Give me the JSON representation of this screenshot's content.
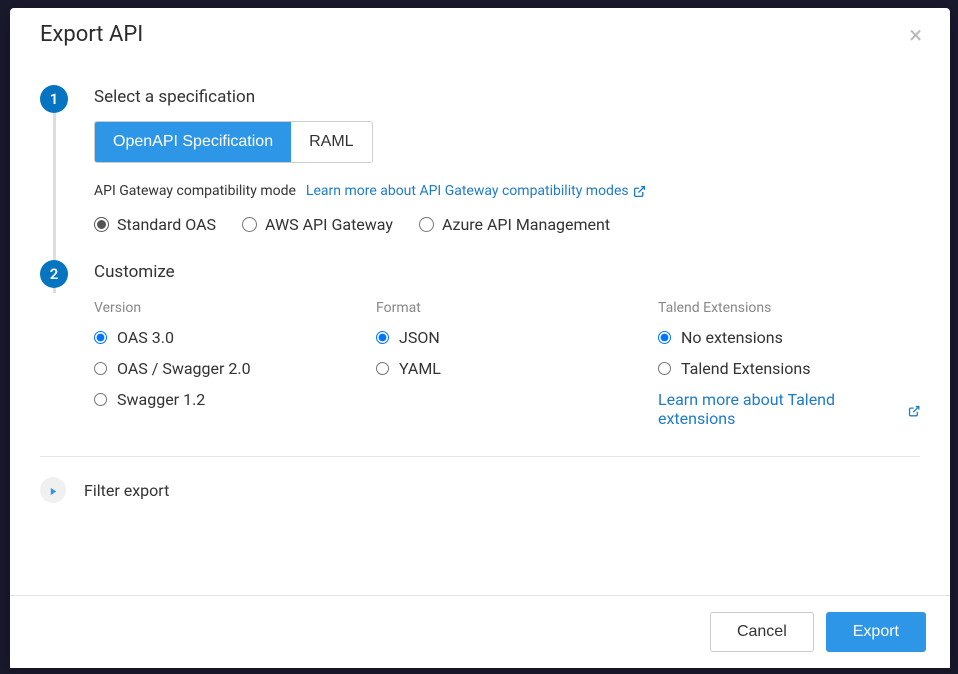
{
  "modal": {
    "title": "Export API",
    "close_label": "×"
  },
  "step1": {
    "number": "1",
    "title": "Select a specification",
    "tabs": {
      "openapi": "OpenAPI Specification",
      "raml": "RAML"
    },
    "compat_label": "API Gateway compatibility mode",
    "compat_link": "Learn more about API Gateway compatibility modes",
    "compat_options": {
      "standard": "Standard OAS",
      "aws": "AWS API Gateway",
      "azure": "Azure API Management"
    }
  },
  "step2": {
    "number": "2",
    "title": "Customize",
    "version": {
      "label": "Version",
      "oas3": "OAS 3.0",
      "oas2": "OAS / Swagger 2.0",
      "swagger12": "Swagger 1.2"
    },
    "format": {
      "label": "Format",
      "json": "JSON",
      "yaml": "YAML"
    },
    "extensions": {
      "label": "Talend Extensions",
      "none": "No extensions",
      "talend": "Talend Extensions",
      "link": "Learn more about Talend extensions"
    }
  },
  "filter": {
    "label": "Filter export"
  },
  "footer": {
    "cancel": "Cancel",
    "export": "Export"
  }
}
